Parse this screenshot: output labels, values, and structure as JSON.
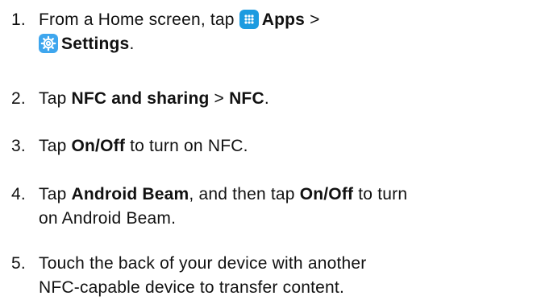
{
  "steps": [
    {
      "number": "1.",
      "pre": "From a Home screen, tap ",
      "icon1": "apps-grid-icon",
      "apps": "Apps",
      "gt": " >",
      "icon2": "settings-gear-icon",
      "settings": "Settings",
      "end": "."
    },
    {
      "number": "2.",
      "pre": "Tap ",
      "b1": "NFC and sharing",
      "mid": " > ",
      "b2": "NFC",
      "end": "."
    },
    {
      "number": "3.",
      "pre": "Tap ",
      "b1": "On/Off",
      "end": " to turn on NFC."
    },
    {
      "number": "4.",
      "pre": "Tap ",
      "b1": "Android Beam",
      "mid": ", and then tap ",
      "b2": "On/Off",
      "end": " to turn",
      "line2": "on Android Beam."
    },
    {
      "number": "5.",
      "line1": "Touch the back of your device with another",
      "line2": "NFC-capable device to transfer content."
    }
  ],
  "colors": {
    "apps_icon_bg": "#1d9be0",
    "settings_icon_bg": "#3ea6ee",
    "text": "#111111"
  }
}
